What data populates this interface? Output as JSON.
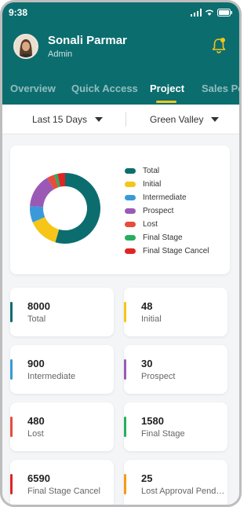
{
  "status_bar": {
    "time": "9:38"
  },
  "profile": {
    "name": "Sonali Parmar",
    "role": "Admin"
  },
  "tabs": [
    {
      "label": "Overview",
      "active": false
    },
    {
      "label": "Quick Access",
      "active": false
    },
    {
      "label": "Project",
      "active": true
    },
    {
      "label": "Sales Pe",
      "active": false
    }
  ],
  "filters": {
    "period": "Last 15 Days",
    "project": "Green Valley"
  },
  "colors": {
    "header": "#0c6d6f",
    "accent": "#f5c518"
  },
  "chart_data": {
    "type": "pie",
    "categories": [
      "Total",
      "Initial",
      "Intermediate",
      "Prospect",
      "Lost",
      "Final Stage",
      "Final Stage Cancel"
    ],
    "values": [
      8000,
      48,
      900,
      30,
      480,
      1580,
      6590
    ],
    "series": [
      {
        "label": "Total",
        "color": "#0c6d6f",
        "share": 0.545
      },
      {
        "label": "Initial",
        "color": "#f5c518",
        "share": 0.14
      },
      {
        "label": "Intermediate",
        "color": "#3a9ad9",
        "share": 0.075
      },
      {
        "label": "Prospect",
        "color": "#9b59b6",
        "share": 0.155
      },
      {
        "label": "Lost",
        "color": "#e74c3c",
        "share": 0.035
      },
      {
        "label": "Final Stage",
        "color": "#27ae60",
        "share": 0.015
      },
      {
        "label": "Final Stage Cancel",
        "color": "#e02424",
        "share": 0.035
      }
    ]
  },
  "stats": [
    {
      "value": "8000",
      "label": "Total",
      "color": "#0c6d6f"
    },
    {
      "value": "48",
      "label": "Initial",
      "color": "#f5c518"
    },
    {
      "value": "900",
      "label": "Intermediate",
      "color": "#3a9ad9"
    },
    {
      "value": "30",
      "label": "Prospect",
      "color": "#9b59b6"
    },
    {
      "value": "480",
      "label": "Lost",
      "color": "#e74c3c"
    },
    {
      "value": "1580",
      "label": "Final Stage",
      "color": "#27ae60"
    },
    {
      "value": "6590",
      "label": "Final Stage Cancel",
      "color": "#e02424"
    },
    {
      "value": "25",
      "label": "Lost Approval Pend…",
      "color": "#f39c12"
    }
  ]
}
